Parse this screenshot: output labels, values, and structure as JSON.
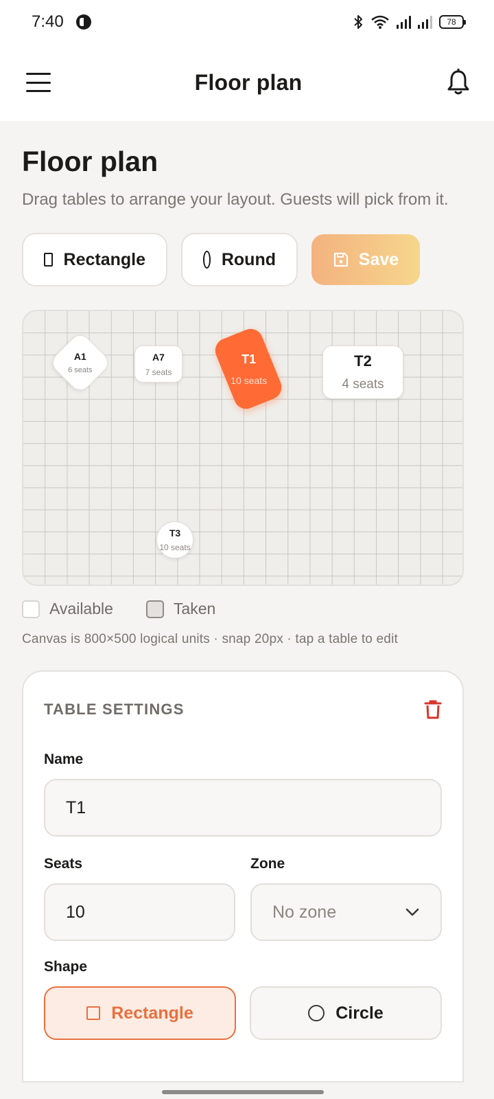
{
  "status_bar": {
    "time": "7:40",
    "battery": "78"
  },
  "app_bar": {
    "title": "Floor plan"
  },
  "page": {
    "title": "Floor plan",
    "description": "Drag tables to arrange your layout. Guests will pick from it."
  },
  "toolbar": {
    "rectangle_label": "Rectangle",
    "round_label": "Round",
    "save_label": "Save"
  },
  "canvas": {
    "tables": [
      {
        "name": "A1",
        "seats": "6 seats",
        "shape": "rotated-square"
      },
      {
        "name": "A7",
        "seats": "7 seats",
        "shape": "rectangle"
      },
      {
        "name": "T1",
        "seats": "10 seats",
        "shape": "rectangle",
        "selected": true
      },
      {
        "name": "T2",
        "seats": "4 seats",
        "shape": "rectangle"
      },
      {
        "name": "T3",
        "seats": "10 seats",
        "shape": "circle"
      }
    ],
    "colors": {
      "selected": "#ff6a35",
      "grid": "#c9c7c2",
      "background": "#efeeea"
    }
  },
  "legend": {
    "available": "Available",
    "taken": "Taken"
  },
  "hint": "Canvas is 800×500 logical units · snap 20px · tap a table to edit",
  "settings": {
    "title": "TABLE SETTINGS",
    "name_label": "Name",
    "name_value": "T1",
    "seats_label": "Seats",
    "seats_value": "10",
    "zone_label": "Zone",
    "zone_value": "No zone",
    "shape_label": "Shape",
    "shape_options": [
      "Rectangle",
      "Circle"
    ],
    "shape_selected": "Rectangle"
  },
  "colors": {
    "accent": "#e8703e",
    "delete": "#d9342b"
  }
}
